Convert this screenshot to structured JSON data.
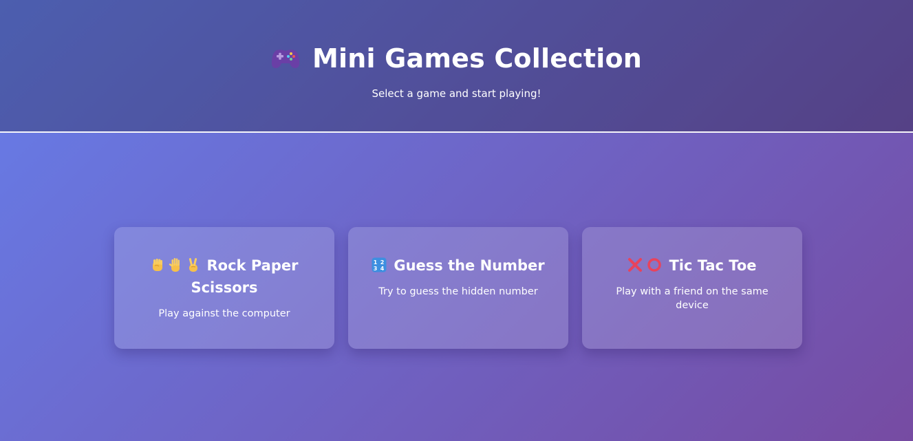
{
  "header": {
    "icon": "game-controller-icon",
    "title": "Mini Games Collection",
    "subtitle": "Select a game and start playing!"
  },
  "games": [
    {
      "icons": [
        "raised-fist-icon",
        "raised-hand-icon",
        "victory-hand-icon"
      ],
      "title": "Rock Paper Scissors",
      "description": "Play against the computer"
    },
    {
      "icons": [
        "numbers-1234-icon"
      ],
      "title": "Guess the Number",
      "description": "Try to guess the hidden number"
    },
    {
      "icons": [
        "cross-mark-icon",
        "hollow-circle-icon"
      ],
      "title": "Tic Tac Toe",
      "description": "Play with a friend on the same device"
    }
  ],
  "colors": {
    "gradient_start": "#667eea",
    "gradient_end": "#764ba2",
    "cross_red": "#e8435c",
    "hand_yellow": "#f6c04a",
    "keycap_blue": "#3d8fe0"
  }
}
